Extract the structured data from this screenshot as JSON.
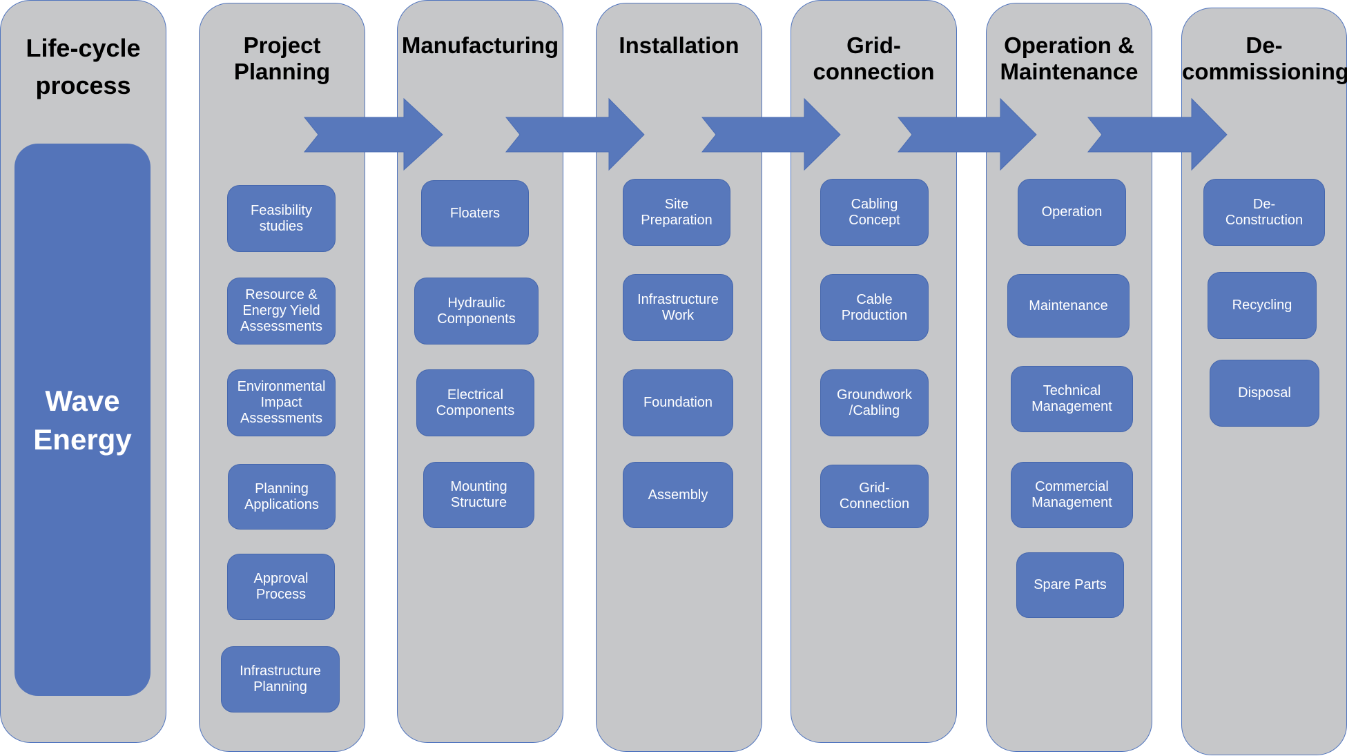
{
  "diagram": {
    "title": "Life-cycle process",
    "subject": "Wave\nEnergy",
    "colors": {
      "column_fill": "#c6c7c9",
      "column_border": "#4e73be",
      "box_fill": "#5878bb",
      "arrow_fill": "#5878bb",
      "text_dark": "#000000",
      "text_light": "#ffffff"
    },
    "stages": [
      {
        "title": "Project\nPlanning",
        "items": [
          "Feasibility\nstudies",
          "Resource &\nEnergy Yield\nAssessments",
          "Environmental\nImpact\nAssessments",
          "Planning\nApplications",
          "Approval\nProcess",
          "Infrastructure\nPlanning"
        ]
      },
      {
        "title": "Manufacturing",
        "items": [
          "Floaters",
          "Hydraulic\nComponents",
          "Electrical\nComponents",
          "Mounting\nStructure"
        ]
      },
      {
        "title": "Installation",
        "items": [
          "Site\nPreparation",
          "Infrastructure\nWork",
          "Foundation",
          "Assembly"
        ]
      },
      {
        "title": "Grid-\nconnection",
        "items": [
          "Cabling\nConcept",
          "Cable\nProduction",
          "Groundwork\n/Cabling",
          "Grid-\nConnection"
        ]
      },
      {
        "title": "Operation &\nMaintenance",
        "items": [
          "Operation",
          "Maintenance",
          "Technical\nManagement",
          "Commercial\nManagement",
          "Spare Parts"
        ]
      },
      {
        "title": "De-\ncommissioning",
        "items": [
          "De-\nConstruction",
          "Recycling",
          "Disposal"
        ]
      }
    ],
    "flow": [
      {
        "from": "Project Planning",
        "to": "Manufacturing"
      },
      {
        "from": "Manufacturing",
        "to": "Installation"
      },
      {
        "from": "Installation",
        "to": "Grid-connection"
      },
      {
        "from": "Grid-connection",
        "to": "Operation & Maintenance"
      },
      {
        "from": "Operation & Maintenance",
        "to": "De-commissioning"
      }
    ]
  }
}
